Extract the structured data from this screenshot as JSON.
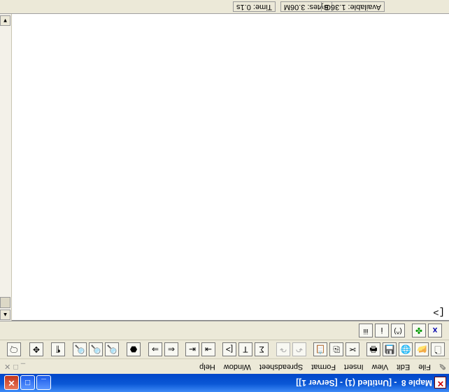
{
  "window": {
    "title": "Maple 8  - [Untitled (1) - [Server 1]]",
    "minimize_glyph": "_",
    "maximize_glyph": "□",
    "close_glyph": "✕"
  },
  "menu": {
    "items": [
      "File",
      "Edit",
      "View",
      "Insert",
      "Format",
      "Spreadsheet",
      "Window",
      "Help"
    ],
    "mdi_controls": [
      "_",
      "□",
      "✕"
    ]
  },
  "toolbar": {
    "standard": [
      "new",
      "open",
      "open-url",
      "save",
      "print",
      "cut",
      "copy",
      "paste",
      "undo",
      "redo",
      "sum",
      "text",
      "prompt",
      "indent",
      "outdent",
      "back",
      "forward",
      "stop",
      "zoom-100",
      "zoom-150",
      "zoom-200",
      "display-toggle",
      "restart",
      "help"
    ],
    "context": [
      "x",
      "maple-leaf",
      "(^)",
      "i",
      "iii"
    ]
  },
  "worksheet": {
    "prompt": "[>"
  },
  "status": {
    "time": "Time: 0.1s",
    "bytes": "Bytes: 3.06M",
    "available": "Available: 1.36G"
  },
  "colors": {
    "titlebar": "#0a57d6",
    "chrome": "#ece9d8",
    "close": "#c2351a"
  }
}
